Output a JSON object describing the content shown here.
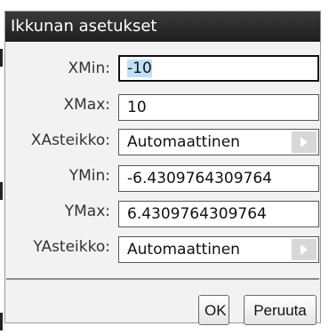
{
  "dialog": {
    "title": "Ikkunan asetukset",
    "xmin": {
      "label": "XMin:",
      "value": "-10"
    },
    "xmax": {
      "label": "XMax:",
      "value": "10"
    },
    "xscale": {
      "label": "XAsteikko:",
      "value": "Automaattinen"
    },
    "ymin": {
      "label": "YMin:",
      "value": "-6.4309764309764"
    },
    "ymax": {
      "label": "YMax:",
      "value": "6.4309764309764"
    },
    "yscale": {
      "label": "YAsteikko:",
      "value": "Automaattinen"
    },
    "ok_label": "OK",
    "cancel_label": "Peruuta"
  },
  "icons": {
    "dropdown": "chevron-right-icon"
  }
}
